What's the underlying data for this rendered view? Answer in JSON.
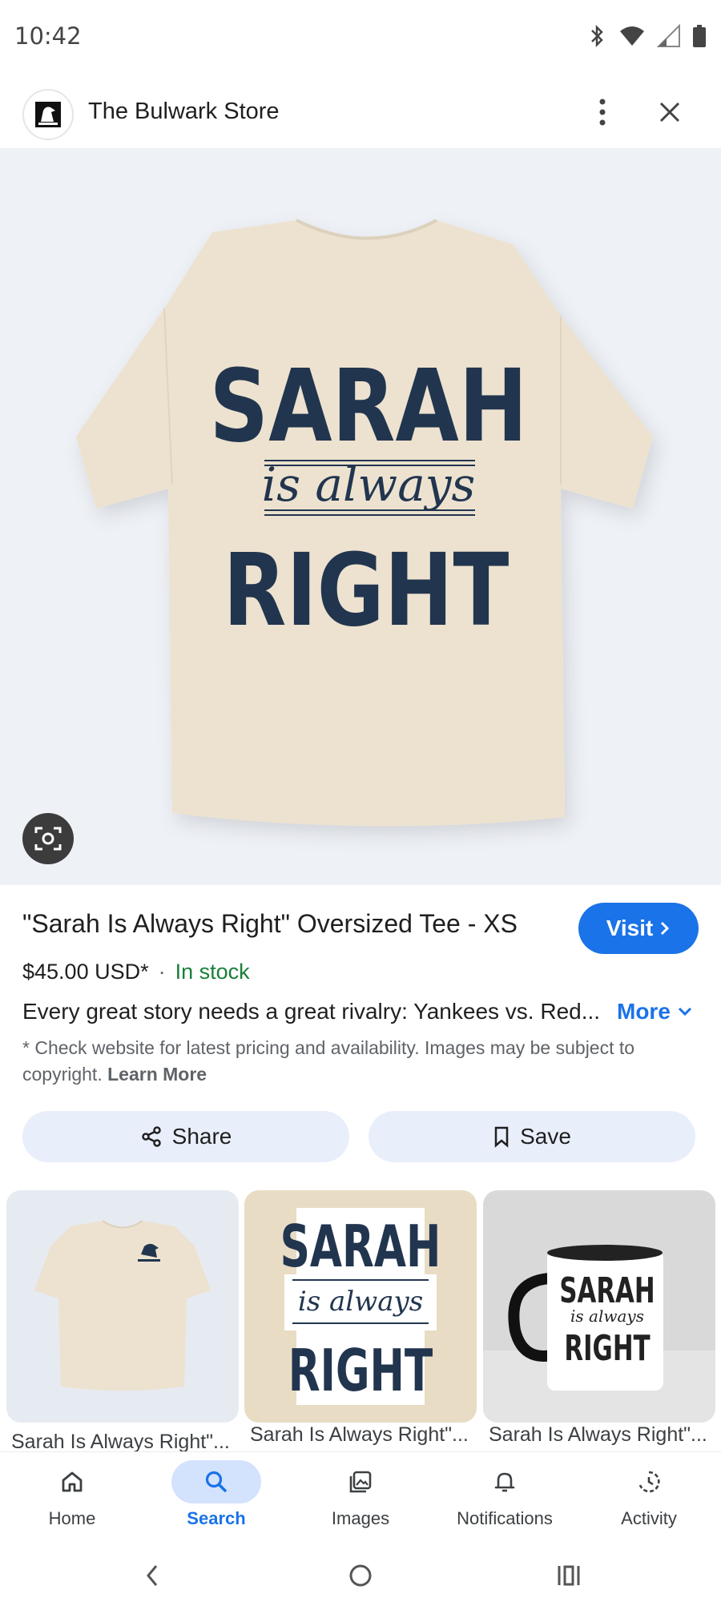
{
  "status_bar": {
    "time": "10:42"
  },
  "header": {
    "store_name": "The Bulwark Store"
  },
  "hero": {
    "shirt_text_1": "SARAH",
    "shirt_text_2": "is always",
    "shirt_text_3": "RIGHT"
  },
  "product": {
    "title": "\"Sarah Is Always Right\" Oversized Tee - XS",
    "visit_label": "Visit",
    "price": "$45.00 USD*",
    "separator": "·",
    "stock": "In stock",
    "description": "Every great story needs a great rivalry: Yankees vs. Red...",
    "more_label": "More",
    "disclaimer": "* Check website for latest pricing and availability. Images may be subject to copyright.",
    "learn_more": "Learn More"
  },
  "actions": {
    "share_label": "Share",
    "save_label": "Save"
  },
  "thumbnails": [
    {
      "caption": "Sarah Is Always Right\"..."
    },
    {
      "caption": "Sarah Is Always Right\"...",
      "text_1": "SARAH",
      "text_2": "is always",
      "text_3": "RIGHT"
    },
    {
      "caption": "Sarah Is Always Right\"...",
      "text_1": "SARAH",
      "text_2": "is always",
      "text_3": "RIGHT"
    }
  ],
  "nav": {
    "items": [
      {
        "label": "Home",
        "icon": "home-icon"
      },
      {
        "label": "Search",
        "icon": "search-icon",
        "active": true
      },
      {
        "label": "Images",
        "icon": "images-icon"
      },
      {
        "label": "Notifications",
        "icon": "bell-icon"
      },
      {
        "label": "Activity",
        "icon": "history-icon"
      }
    ]
  },
  "colors": {
    "accent": "#1a73e8",
    "in_stock": "#188038",
    "shirt": "#ece2cf",
    "print_navy": "#22354f"
  }
}
